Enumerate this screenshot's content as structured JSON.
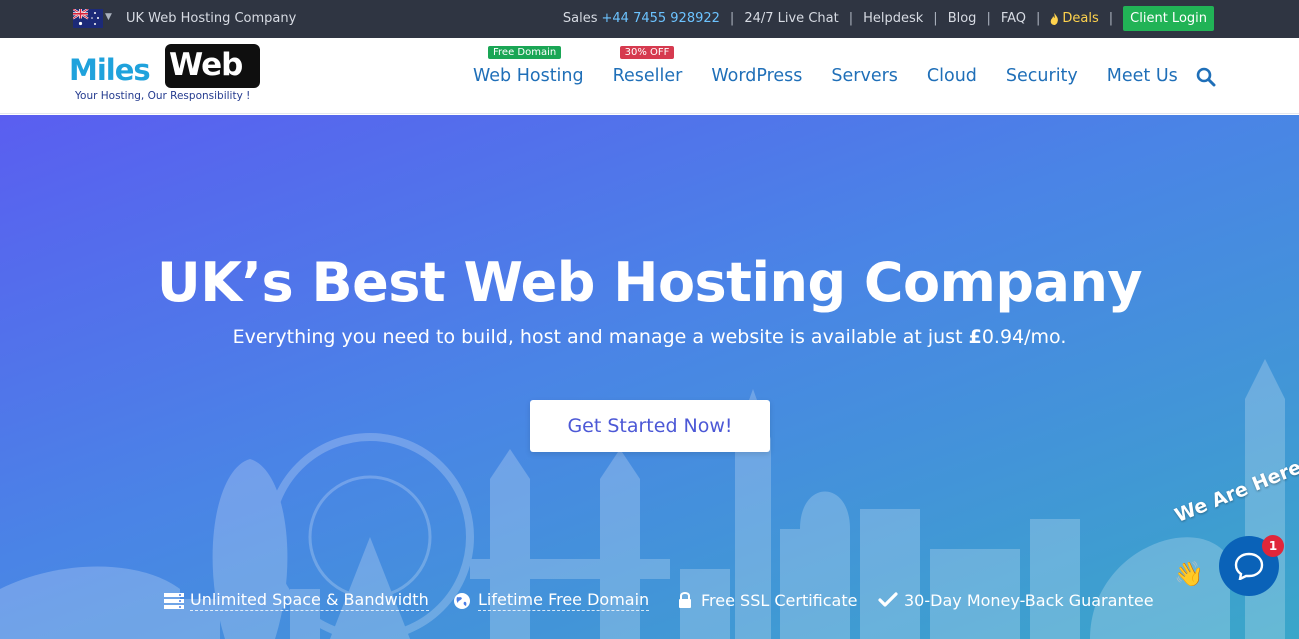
{
  "topbar": {
    "company": "UK Web Hosting Company",
    "sales_label": "Sales",
    "sales_phone": "+44 7455 928922",
    "live_chat": "24/7 Live Chat",
    "helpdesk": "Helpdesk",
    "blog": "Blog",
    "faq": "FAQ",
    "deals": "Deals",
    "client_login": "Client Login",
    "separator": "|"
  },
  "logo": {
    "miles": "Miles",
    "web": "Web",
    "tagline": "Your Hosting, Our Responsibility !"
  },
  "nav": {
    "items": [
      {
        "label": "Web Hosting",
        "badge": "Free Domain"
      },
      {
        "label": "Reseller",
        "badge": "30% OFF"
      },
      {
        "label": "WordPress"
      },
      {
        "label": "Servers"
      },
      {
        "label": "Cloud"
      },
      {
        "label": "Security"
      },
      {
        "label": "Meet Us"
      }
    ],
    "search_icon": "search-icon"
  },
  "hero": {
    "title": "UK’s Best Web Hosting Company",
    "subtitle_prefix": "Everything you need to build, host and manage a website is available at just ",
    "subtitle_currency": "£",
    "subtitle_price": "0.94/mo.",
    "cta": "Get Started Now!"
  },
  "features": [
    {
      "icon": "server-icon",
      "label": "Unlimited Space & Bandwidth"
    },
    {
      "icon": "globe-icon",
      "label": "Lifetime Free Domain"
    },
    {
      "icon": "lock-icon",
      "label": "Free SSL Certificate"
    },
    {
      "icon": "check-icon",
      "label": "30-Day Money-Back Guarantee"
    }
  ],
  "chat": {
    "tagline": "We Are Here!",
    "count": "1"
  },
  "colors": {
    "topbar_bg": "#2f3542",
    "nav_link": "#1f6fb8",
    "login_green": "#21b356",
    "hero_start": "#5a5ef0",
    "hero_end": "#3aa6c9",
    "cta_text": "#4c58d6"
  }
}
